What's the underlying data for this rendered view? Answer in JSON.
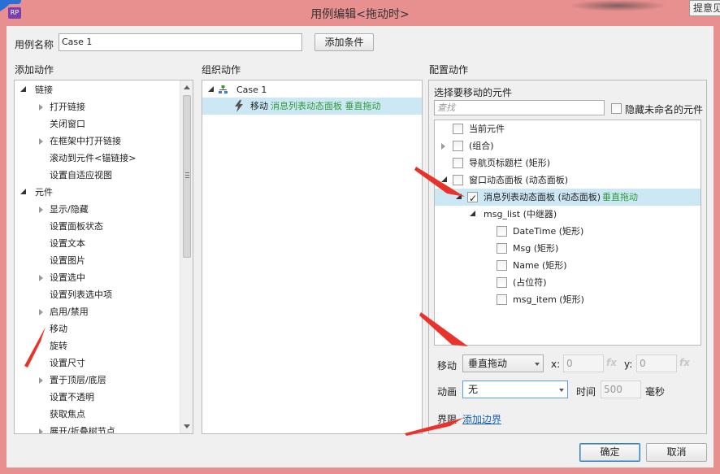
{
  "window": {
    "title": "用例编辑<拖动时>",
    "app_icon_text": "RP",
    "tooltip": "提意见"
  },
  "case_name": {
    "label": "用例名称",
    "value": "Case 1",
    "add_condition": "添加条件"
  },
  "add_action": {
    "heading": "添加动作",
    "items": [
      {
        "label": "链接"
      },
      {
        "label": "打开链接"
      },
      {
        "label": "关闭窗口"
      },
      {
        "label": "在框架中打开链接"
      },
      {
        "label": "滚动到元件<锚链接>"
      },
      {
        "label": "设置自适应视图"
      },
      {
        "label": "元件"
      },
      {
        "label": "显示/隐藏"
      },
      {
        "label": "设置面板状态"
      },
      {
        "label": "设置文本"
      },
      {
        "label": "设置图片"
      },
      {
        "label": "设置选中"
      },
      {
        "label": "设置列表选中项"
      },
      {
        "label": "启用/禁用"
      },
      {
        "label": "移动"
      },
      {
        "label": "旋转"
      },
      {
        "label": "设置尺寸"
      },
      {
        "label": "置于顶层/底层"
      },
      {
        "label": "设置不透明"
      },
      {
        "label": "获取焦点"
      },
      {
        "label": "展开/折叠树节点"
      }
    ]
  },
  "organize_action": {
    "heading": "组织动作",
    "case_label": "Case 1",
    "action_verb": "移动",
    "action_target": "消息列表动态面板 垂直拖动"
  },
  "configure_action": {
    "heading": "配置动作",
    "select_label": "选择要移动的元件",
    "search_placeholder": "查找",
    "hide_unnamed": "隐藏未命名的元件",
    "tree": [
      {
        "label": "当前元件"
      },
      {
        "label": "(组合)"
      },
      {
        "label": "导航页标题栏 (矩形)"
      },
      {
        "label": "窗口动态面板 (动态面板)"
      },
      {
        "label": "消息列表动态面板 (动态面板)",
        "suffix": "垂直拖动"
      },
      {
        "label": "msg_list (中继器)"
      },
      {
        "label": "DateTime (矩形)"
      },
      {
        "label": "Msg (矩形)"
      },
      {
        "label": "Name (矩形)"
      },
      {
        "label": "(占位符)"
      },
      {
        "label": "msg_item (矩形)"
      }
    ],
    "move_label": "移动",
    "move_value": "垂直拖动",
    "x_label": "x:",
    "x_value": "0",
    "y_label": "y:",
    "y_value": "0",
    "fx": "fx",
    "anim_label": "动画",
    "anim_value": "无",
    "time_label": "时间",
    "time_value": "500",
    "ms_label": "毫秒",
    "bounds_label": "界限",
    "add_bounds": "添加边界"
  },
  "footer": {
    "ok": "确定",
    "cancel": "取消"
  },
  "colors": {
    "frame": "#e88f8f",
    "selection": "#cce8f4",
    "accent_green": "#2f9a36",
    "arrow_red": "#e8322a"
  }
}
